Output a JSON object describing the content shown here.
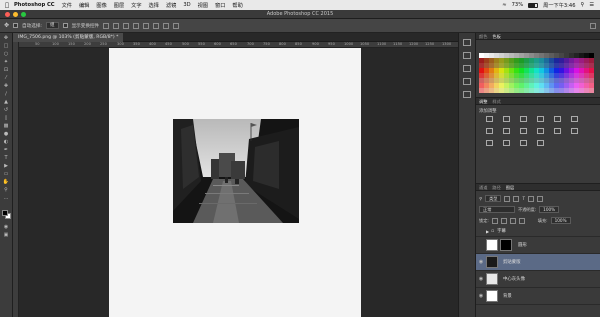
{
  "menubar": {
    "app_name": "Photoshop CC",
    "items": [
      "文件",
      "编辑",
      "图像",
      "图层",
      "文字",
      "选择",
      "滤镜",
      "3D",
      "视图",
      "窗口",
      "帮助"
    ],
    "battery": "73%",
    "clock": "周一下午3:46"
  },
  "window": {
    "title": "Adobe Photoshop CC 2015"
  },
  "options": {
    "auto_select_label": "自动选择:",
    "auto_select_value": "组",
    "show_transform_label": "显示变换控件"
  },
  "document": {
    "tab_label": "IMG_7506.png @ 103% (剪贴蒙版, RGB/8*) *"
  },
  "ruler": {
    "ticks": [
      "50",
      "100",
      "150",
      "200",
      "250",
      "300",
      "350",
      "400",
      "450",
      "500",
      "550",
      "600",
      "650",
      "700",
      "750",
      "800",
      "850",
      "900",
      "950",
      "1000",
      "1050",
      "1100",
      "1150",
      "1200",
      "1250",
      "1300"
    ]
  },
  "panels": {
    "swatches_tabs": [
      "颜色",
      "色板"
    ],
    "adjustments_tabs": [
      "调整",
      "样式"
    ],
    "adjustments_label": "添加调整",
    "layers_tabs": [
      "通道",
      "路径",
      "图层"
    ],
    "layer_filter": "类型",
    "blend_mode": "正常",
    "opacity_label": "不透明度:",
    "opacity_value": "100%",
    "lock_label": "锁定:",
    "fill_label": "填充:",
    "fill_value": "100%",
    "layers": [
      {
        "name": "字幕",
        "type": "group"
      },
      {
        "name": "圆形",
        "type": "shape"
      },
      {
        "name": "剪贴蒙版",
        "type": "pixel"
      },
      {
        "name": "中心灰头像",
        "type": "pixel"
      },
      {
        "name": "背景",
        "type": "background"
      }
    ]
  }
}
